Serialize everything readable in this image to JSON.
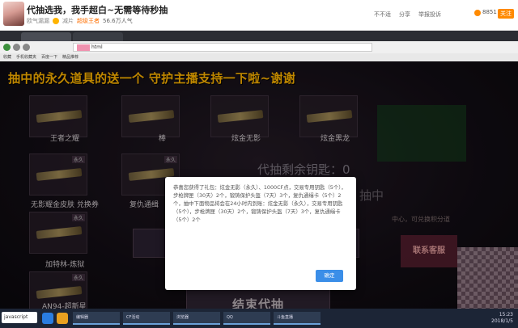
{
  "header": {
    "title": "代抽选我，我手超白~无需等待秒抽",
    "host_name": "欧气漏漏",
    "level_badge": "减片",
    "follow_label": "超级王者",
    "popularity": "56.6万人气",
    "actions": [
      "不不适",
      "分享",
      "举报投诉"
    ],
    "counter": "8851",
    "follow_tag": "关注"
  },
  "browser": {
    "url": "html",
    "bookmarks": [
      "收藏",
      "手机收藏夹",
      "百度一下",
      "精品推荐"
    ]
  },
  "game": {
    "banner": "抽中的永久道具的送一个 守护主播支持一下啦~谢谢",
    "remaining_keys": "代抽剩余钥匙：0",
    "drawing_status": "抽中",
    "side_hint": "中心，可兑换积分道",
    "right_button": "联系客服",
    "end_button": "结束代抽",
    "card_tag": "永久",
    "cards": [
      {
        "label": "王者之耀"
      },
      {
        "label": "棒"
      },
      {
        "label": "炫金无影"
      },
      {
        "label": "炫金黑龙"
      },
      {
        "label": "无影耀金皮肤 兑换券"
      },
      {
        "label": "复仇通缉"
      },
      {
        "label": "加特林-炼狱"
      },
      {
        "label": "AN94-超新星"
      }
    ]
  },
  "dialog": {
    "message": "恭喜您获得了礼包：炫金无影（永久）、1000CF点，交易专用钥匙（5个），步枪牌匣（30天）2个，锻铸保护头盔（7天）3个，复仇通缉卡（5个）2个，抽中下面物品将会在24小时内到账：炫金无影（永久），交易专用钥匙（5个），步枪牌匣（30天）2个，锻铸保护头盔（7天）3个，复仇通缉卡（5个）2个",
    "ok_label": "确定"
  },
  "taskbar": {
    "search": "javascript",
    "windows": [
      "编辑器",
      "CF活动",
      "浏览器",
      "QQ",
      "斗鱼直播"
    ],
    "time": "15:23",
    "date": "2018/1/5"
  }
}
